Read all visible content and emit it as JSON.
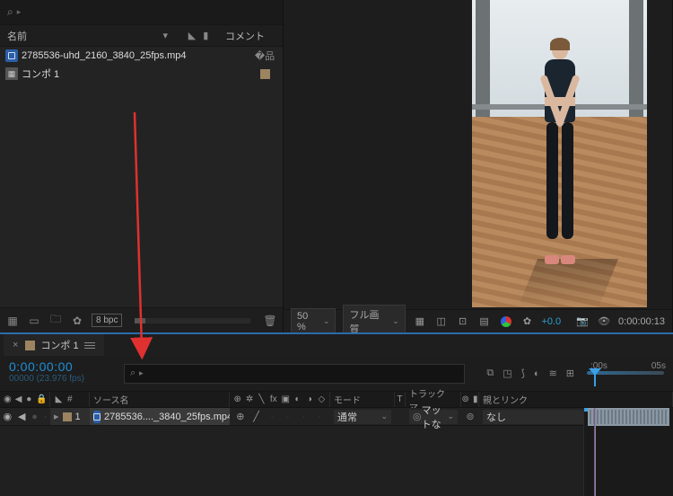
{
  "project": {
    "search_placeholder": "",
    "columns": {
      "name": "名前",
      "comment": "コメント"
    },
    "items": [
      {
        "name": "2785536-uhd_2160_3840_25fps.mp4",
        "type": "video",
        "end_icon": "flowchart"
      },
      {
        "name": "コンポ 1",
        "type": "comp",
        "end_icon": "swatch"
      }
    ],
    "footer": {
      "bpc": "8 bpc"
    }
  },
  "viewer": {
    "zoom": "50 %",
    "resolution": "フル画質",
    "exposure": "+0.0",
    "timecode": "0:00:00:13"
  },
  "timeline": {
    "tab_name": "コンポ 1",
    "current_time": "0:00:00:00",
    "frame_info": "00000 (23.976 fps)",
    "columns": {
      "source": "ソース名",
      "mode": "モード",
      "t": "T",
      "track_matte": "トラックマ...",
      "parent": "親とリンク"
    },
    "ruler": {
      "marks": [
        ":00s",
        "05s"
      ]
    },
    "layers": [
      {
        "index": "1",
        "name": "2785536...._3840_25fps.mp4",
        "mode": "通常",
        "track_matte": "マットな",
        "parent": "なし"
      }
    ]
  }
}
